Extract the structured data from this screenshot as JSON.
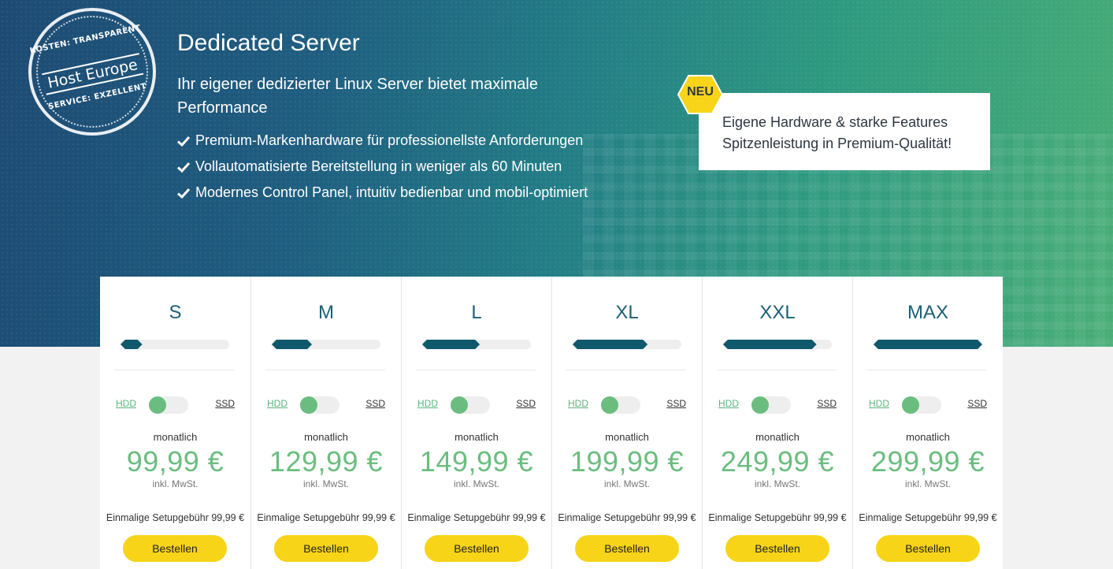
{
  "colors": {
    "accent_green": "#6bbd7f",
    "button_yellow": "#f7d417",
    "bar_fill": "#10586b",
    "title_blue": "#1b5f75"
  },
  "seal": {
    "top": "KOSTEN: TRANSPARENT",
    "brand": "Host Europe",
    "bottom": "SERVICE: EXZELLENT"
  },
  "hero": {
    "title": "Dedicated Server",
    "subtitle": "Ihr eigener dedizierter Linux Server bietet maximale Performance",
    "features": [
      "Premium-Markenhardware für professionellste Anforderungen",
      "Vollautomatisierte Bereitstellung in weniger als 60 Minuten",
      "Modernes Control Panel, intuitiv bedienbar und mobil-optimiert"
    ],
    "check_icon": "check-icon"
  },
  "promo": {
    "badge": "NEU",
    "line1": "Eigene Hardware & starke Features",
    "line2": "Spitzenleistung in Premium-Qualität!"
  },
  "plans": [
    {
      "name": "S",
      "level": 0.2,
      "hdd": "HDD",
      "ssd": "SSD",
      "period": "monatlich",
      "price": "99,99 €",
      "vat": "inkl. MwSt.",
      "setup": "Einmalige Setupgebühr 99,99 €",
      "order": "Bestellen"
    },
    {
      "name": "M",
      "level": 0.37,
      "hdd": "HDD",
      "ssd": "SSD",
      "period": "monatlich",
      "price": "129,99 €",
      "vat": "inkl. MwSt.",
      "setup": "Einmalige Setupgebühr 99,99 €",
      "order": "Bestellen"
    },
    {
      "name": "L",
      "level": 0.53,
      "hdd": "HDD",
      "ssd": "SSD",
      "period": "monatlich",
      "price": "149,99 €",
      "vat": "inkl. MwSt.",
      "setup": "Einmalige Setupgebühr 99,99 €",
      "order": "Bestellen"
    },
    {
      "name": "XL",
      "level": 0.69,
      "hdd": "HDD",
      "ssd": "SSD",
      "period": "monatlich",
      "price": "199,99 €",
      "vat": "inkl. MwSt.",
      "setup": "Einmalige Setupgebühr 99,99 €",
      "order": "Bestellen"
    },
    {
      "name": "XXL",
      "level": 0.86,
      "hdd": "HDD",
      "ssd": "SSD",
      "period": "monatlich",
      "price": "249,99 €",
      "vat": "inkl. MwSt.",
      "setup": "Einmalige Setupgebühr 99,99 €",
      "order": "Bestellen"
    },
    {
      "name": "MAX",
      "level": 1.0,
      "hdd": "HDD",
      "ssd": "SSD",
      "period": "monatlich",
      "price": "299,99 €",
      "vat": "inkl. MwSt.",
      "setup": "Einmalige Setupgebühr 99,99 €",
      "order": "Bestellen"
    }
  ]
}
